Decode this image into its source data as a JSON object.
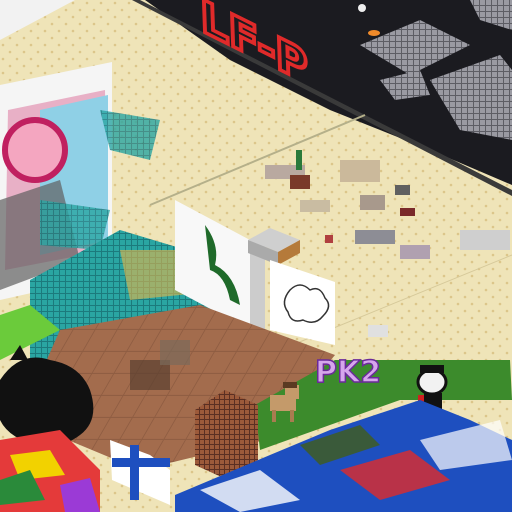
{
  "scene": {
    "type": "isometric-voxel-world",
    "colors": {
      "sand": "#efe4b8",
      "sand_dot": "#e3cf95",
      "dark_floor": "#1b1b20",
      "sign_red": "#e02a2a",
      "teal": "#1f8b8b",
      "grass": "#3c8b2c",
      "brick": "#8a5a40",
      "blue_mural": "#1e4fbf"
    }
  },
  "signs": {
    "large_floor_text": "LF-P",
    "purple_text": "PK2"
  },
  "icons": [
    "voxel-structure-icon",
    "character-figure-icon",
    "pony-figure-icon",
    "flag-icon"
  ]
}
